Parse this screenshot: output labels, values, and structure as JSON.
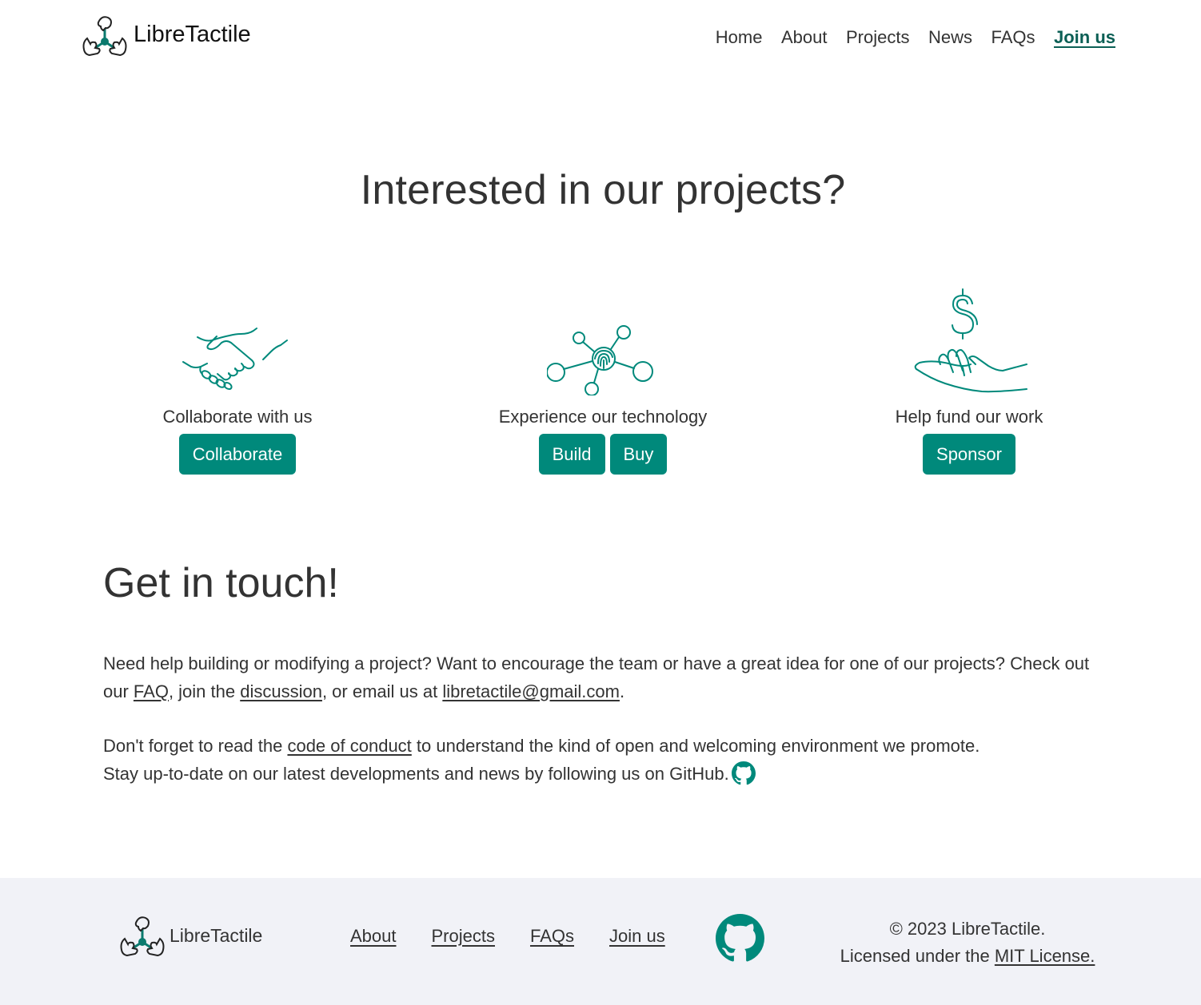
{
  "brand": {
    "name": "LibreTactile"
  },
  "nav": {
    "items": [
      {
        "label": "Home"
      },
      {
        "label": "About"
      },
      {
        "label": "Projects"
      },
      {
        "label": "News"
      },
      {
        "label": "FAQs"
      },
      {
        "label": "Join us",
        "active": true
      }
    ]
  },
  "hero": {
    "title": "Interested in our projects?"
  },
  "cards": [
    {
      "icon": "handshake-icon",
      "label": "Collaborate with us",
      "buttons": [
        "Collaborate"
      ]
    },
    {
      "icon": "fingerprint-network-icon",
      "label": "Experience our technology",
      "buttons": [
        "Build",
        "Buy"
      ]
    },
    {
      "icon": "dollar-hand-icon",
      "label": "Help fund our work",
      "buttons": [
        "Sponsor"
      ]
    }
  ],
  "touch": {
    "title": "Get in touch!",
    "p1_part1": "Need help building or modifying a project? Want to encourage the team or have a great idea for one of our projects? Check out our ",
    "faq_link": "FAQ",
    "p1_part2": ", join the ",
    "discussion_link": "discussion",
    "p1_part3": ", or email us at ",
    "email_link": "libretactile@gmail.com",
    "p1_part4": ".",
    "p2_part1": "Don't forget to read the ",
    "coc_link": "code of conduct",
    "p2_part2": " to understand the kind of open and welcoming environment we promote.",
    "p3": "Stay up-to-date on our latest developments and news by following us on GitHub."
  },
  "footer": {
    "brand": "LibreTactile",
    "links": [
      {
        "label": "About"
      },
      {
        "label": "Projects"
      },
      {
        "label": "FAQs"
      },
      {
        "label": "Join us"
      }
    ],
    "copyright": "© 2023 LibreTactile.",
    "license_prefix": "Licensed under the ",
    "license_link": "MIT License."
  },
  "colors": {
    "accent": "#00897b",
    "active_nav": "#0b5f55",
    "footer_bg": "#f1f2f7"
  }
}
